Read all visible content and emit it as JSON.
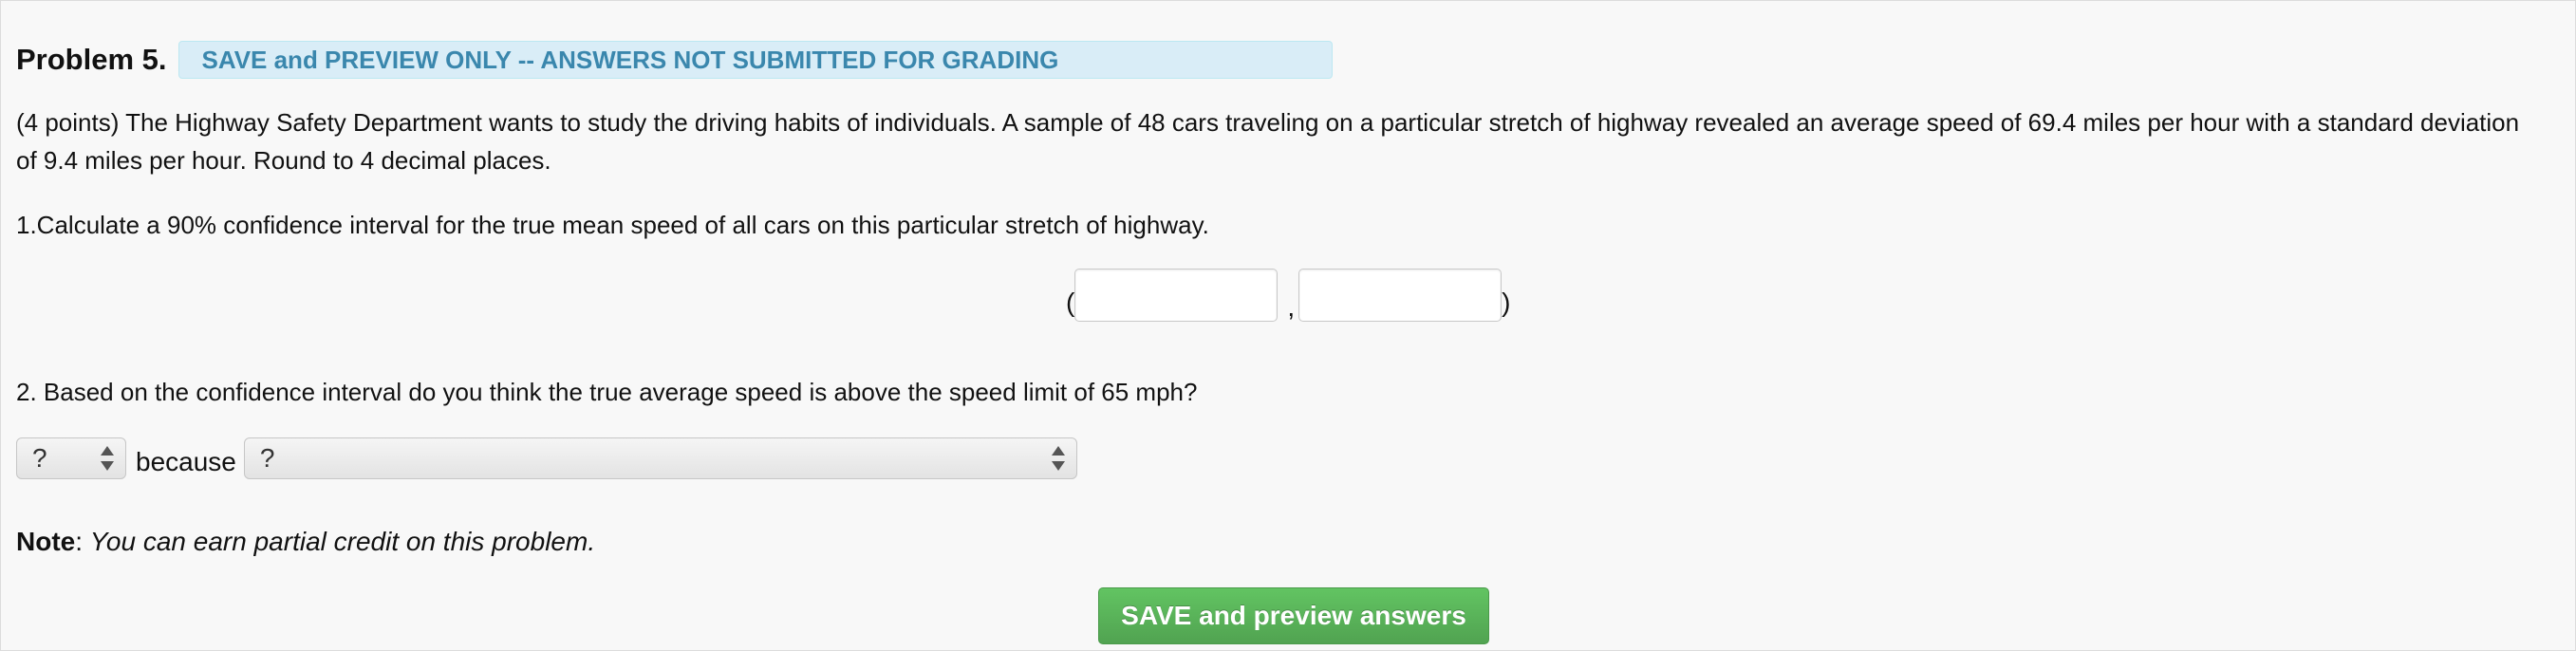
{
  "problem": {
    "title": "Problem 5.",
    "badge": "SAVE and PREVIEW ONLY -- ANSWERS NOT SUBMITTED FOR GRADING",
    "intro": "(4 points) The Highway Safety Department wants to study the driving habits of individuals. A sample of 48 cars traveling on a particular stretch of highway revealed an average speed of 69.4 miles per hour with a standard deviation of 9.4 miles per hour. Round to 4 decimal places."
  },
  "question1": {
    "text": "1.Calculate a 90% confidence interval for the true mean speed of all cars on this particular stretch of highway.",
    "open_paren": "(",
    "separator": ",",
    "close_paren": ")",
    "lower_value": "",
    "upper_value": ""
  },
  "question2": {
    "text": "2. Based on the confidence interval do you think the true average speed is above the speed limit of 65 mph?",
    "answer_select": "?",
    "because_label": "because",
    "reason_select": "?"
  },
  "note": {
    "label": "Note",
    "separator": ":",
    "text": "You can earn partial credit on this problem."
  },
  "submit_button": "SAVE and preview answers",
  "colors": {
    "badge_bg": "#d9edf7",
    "badge_text": "#3a87ad",
    "button_green": "#51a351"
  }
}
